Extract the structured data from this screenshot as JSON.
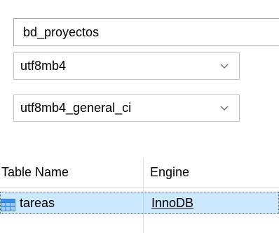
{
  "database": {
    "name_value": "bd_proyectos"
  },
  "charset": {
    "selected": "utf8mb4",
    "icon": "chevron-down-icon"
  },
  "collation": {
    "selected": "utf8mb4_general_ci",
    "icon": "chevron-down-icon"
  },
  "tables": {
    "columns": [
      "Table Name",
      "Engine"
    ],
    "rows": [
      {
        "name": "tareas",
        "engine": "InnoDB",
        "icon": "table-icon"
      }
    ]
  },
  "colors": {
    "selection": "#cce8ff",
    "table_icon": "#3a8ee6"
  }
}
